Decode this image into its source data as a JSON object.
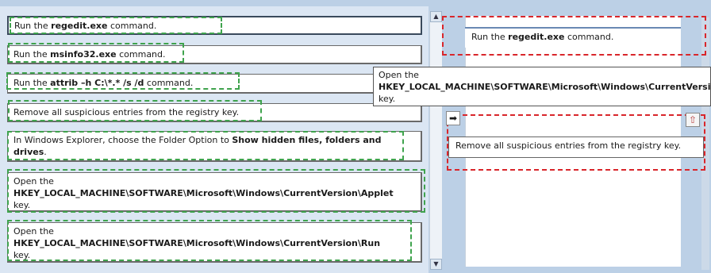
{
  "source_list": {
    "items": [
      {
        "pre": "Run the ",
        "bold": "regedit.exe",
        "post": " command.",
        "selected": true
      },
      {
        "pre": "Run the ",
        "bold": "msinfo32.exe",
        "post": " command."
      },
      {
        "pre": "Run the ",
        "bold": "attrib –h C:\\*.* /s /d",
        "post": " command."
      },
      {
        "pre": "Remove all suspicious entries from the registry key.",
        "bold": "",
        "post": ""
      },
      {
        "pre": "In Windows Explorer, choose the Folder Option to ",
        "bold": "Show hidden files, folders and drives",
        "post": "."
      },
      {
        "pre": "Open the",
        "bold": "HKEY_LOCAL_MACHINE\\SOFTWARE\\Microsoft\\Windows\\CurrentVersion\\Applet",
        "post": "key."
      },
      {
        "pre": "Open the",
        "bold": "HKEY_LOCAL_MACHINE\\SOFTWARE\\Microsoft\\Windows\\CurrentVersion\\Run",
        "post": "key."
      }
    ]
  },
  "target_list": {
    "slot1": {
      "pre": "Run the ",
      "bold": "regedit.exe",
      "post": " command."
    },
    "slot2": {
      "pre": "Remove all suspicious entries from the registry key."
    }
  },
  "tooltip": {
    "pre": "Open the",
    "bold": "HKEY_LOCAL_MACHINE\\SOFTWARE\\Microsoft\\Windows\\CurrentVersion\\",
    "post": "key."
  },
  "icons": {
    "move_right": "arrow-right-icon",
    "move_up": "arrow-up-icon",
    "scroll_up": "triangle-up-icon",
    "scroll_down": "triangle-down-icon"
  },
  "colors": {
    "correct_outline": "#3fa34d",
    "wrong_outline": "#d9262b",
    "background": "#bcd0e6"
  }
}
